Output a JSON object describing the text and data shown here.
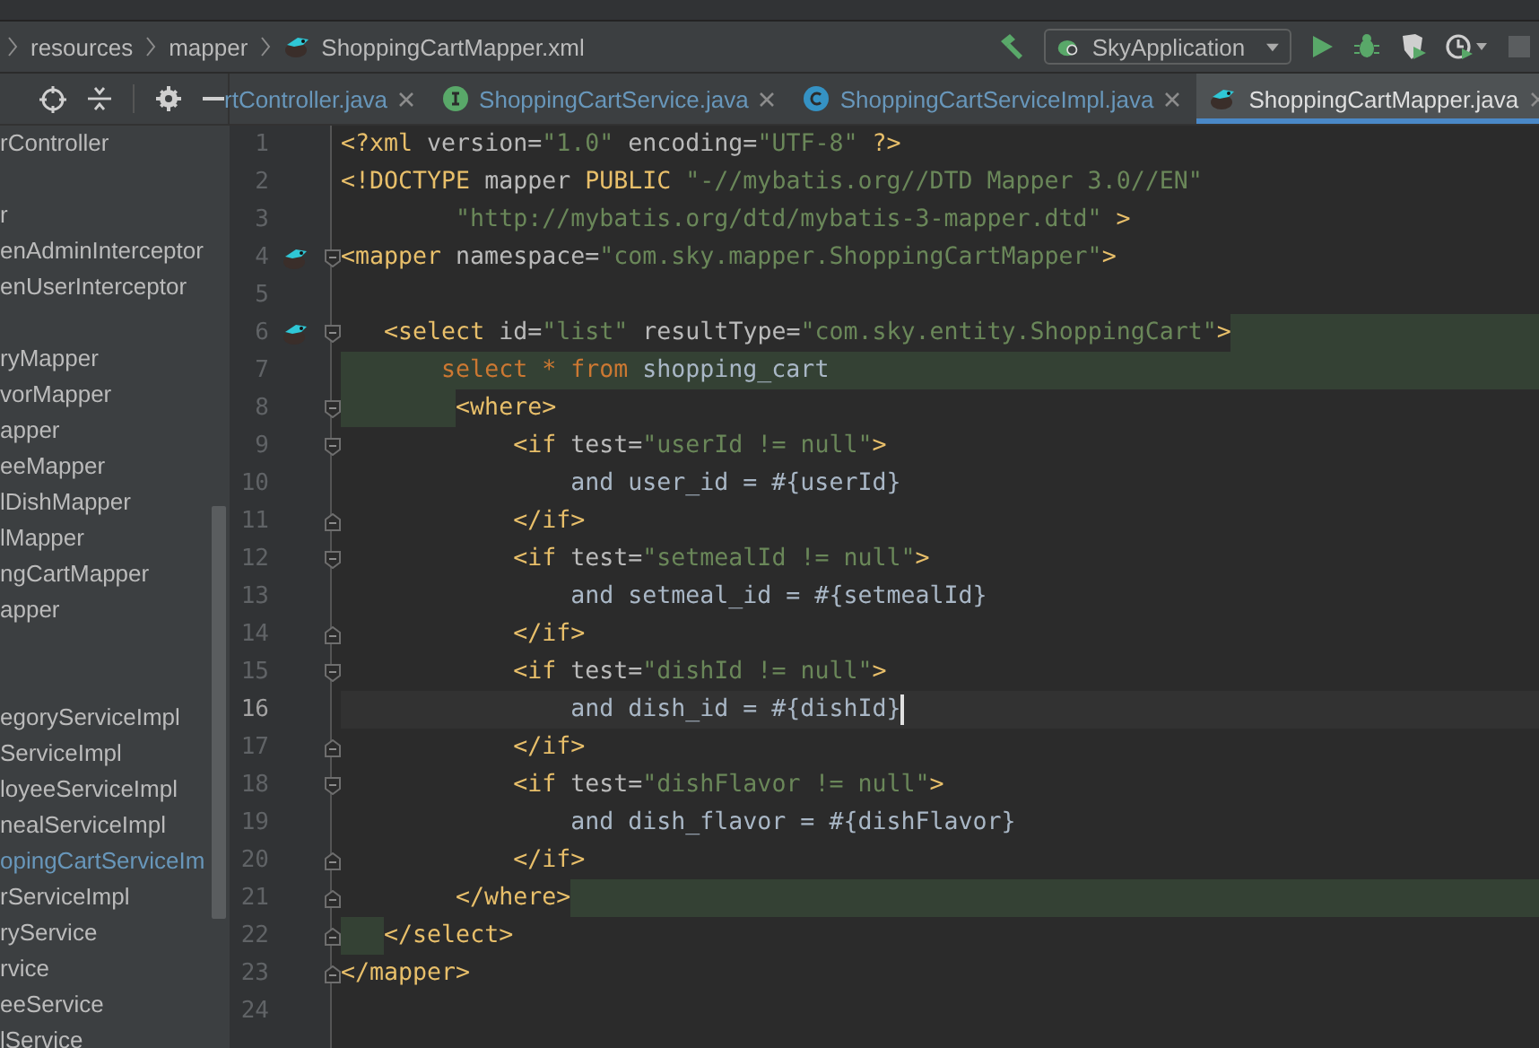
{
  "breadcrumb": {
    "items": [
      {
        "label": "resources",
        "kind": "folder"
      },
      {
        "label": "mapper",
        "kind": "folder"
      },
      {
        "label": "ShoppingCartMapper.xml",
        "kind": "xml"
      }
    ]
  },
  "toolbar": {
    "run_config": "SkyApplication"
  },
  "tabs": [
    {
      "label": "rtController.java",
      "kind": "plain",
      "selected": false,
      "modified": true
    },
    {
      "label": "ShoppingCartService.java",
      "kind": "interface",
      "selected": false,
      "modified": true
    },
    {
      "label": "ShoppingCartServiceImpl.java",
      "kind": "class",
      "selected": false,
      "modified": true
    },
    {
      "label": "ShoppingCartMapper.java",
      "kind": "mapper",
      "selected": true,
      "modified": false
    }
  ],
  "sidebar": {
    "items": [
      {
        "kind": "file",
        "label": "rController",
        "modified": false
      },
      {
        "kind": "spacer"
      },
      {
        "kind": "file",
        "label": "r",
        "modified": false
      },
      {
        "kind": "file",
        "label": "enAdminInterceptor",
        "modified": false
      },
      {
        "kind": "file",
        "label": "enUserInterceptor",
        "modified": false
      },
      {
        "kind": "spacer"
      },
      {
        "kind": "file",
        "label": "ryMapper",
        "modified": false
      },
      {
        "kind": "file",
        "label": "vorMapper",
        "modified": false
      },
      {
        "kind": "file",
        "label": "apper",
        "modified": false
      },
      {
        "kind": "file",
        "label": "eeMapper",
        "modified": false
      },
      {
        "kind": "file",
        "label": "lDishMapper",
        "modified": false
      },
      {
        "kind": "file",
        "label": "lMapper",
        "modified": false
      },
      {
        "kind": "file",
        "label": "ngCartMapper",
        "modified": false
      },
      {
        "kind": "file",
        "label": "apper",
        "modified": false
      },
      {
        "kind": "spacer"
      },
      {
        "kind": "spacer"
      },
      {
        "kind": "file",
        "label": "egoryServiceImpl",
        "modified": false
      },
      {
        "kind": "file",
        "label": "ServiceImpl",
        "modified": false
      },
      {
        "kind": "file",
        "label": "loyeeServiceImpl",
        "modified": false
      },
      {
        "kind": "file",
        "label": "nealServiceImpl",
        "modified": false
      },
      {
        "kind": "file",
        "label": "opingCartServiceIm",
        "modified": true
      },
      {
        "kind": "file",
        "label": "rServiceImpl",
        "modified": false
      },
      {
        "kind": "file",
        "label": "ryService",
        "modified": false
      },
      {
        "kind": "file",
        "label": "rvice",
        "modified": false
      },
      {
        "kind": "file",
        "label": "eeService",
        "modified": false
      },
      {
        "kind": "file",
        "label": "lService",
        "modified": false
      }
    ]
  },
  "editor": {
    "lines": [
      {
        "number": "1",
        "kind": "plain",
        "marker": false,
        "fold_start": false,
        "fold_end": false,
        "current": false,
        "tokens": [
          {
            "kind": "tag",
            "text": "<?xml "
          },
          {
            "kind": "attr",
            "text": "version="
          },
          {
            "kind": "str",
            "text": "\"1.0\" "
          },
          {
            "kind": "attr",
            "text": "encoding="
          },
          {
            "kind": "str",
            "text": "\"UTF-8\" "
          },
          {
            "kind": "tag",
            "text": "?>"
          }
        ]
      },
      {
        "number": "2",
        "kind": "plain",
        "marker": false,
        "fold_start": false,
        "fold_end": false,
        "current": false,
        "tokens": [
          {
            "kind": "tag",
            "text": "<!DOCTYPE "
          },
          {
            "kind": "attr",
            "text": "mapper "
          },
          {
            "kind": "tag",
            "text": "PUBLIC "
          },
          {
            "kind": "str",
            "text": "\"-//mybatis.org//DTD Mapper 3.0//EN\""
          }
        ]
      },
      {
        "number": "3",
        "kind": "plain",
        "marker": false,
        "fold_start": false,
        "fold_end": false,
        "current": false,
        "tokens": [
          {
            "kind": "str",
            "text": "        \"http://mybatis.org/dtd/mybatis-3-mapper.dtd\" "
          },
          {
            "kind": "tag",
            "text": ">"
          }
        ]
      },
      {
        "number": "4",
        "kind": "plain",
        "marker": true,
        "fold_start": true,
        "fold_end": false,
        "current": false,
        "tokens": [
          {
            "kind": "tag",
            "text": "<mapper "
          },
          {
            "kind": "attr",
            "text": "namespace="
          },
          {
            "kind": "str",
            "text": "\"com.sky.mapper.ShoppingCartMapper\""
          },
          {
            "kind": "tag",
            "text": ">"
          }
        ]
      },
      {
        "number": "5",
        "kind": "plain",
        "marker": false,
        "fold_start": false,
        "fold_end": false,
        "current": false
      },
      {
        "number": "6",
        "kind": "tail",
        "marker": true,
        "fold_start": true,
        "fold_end": false,
        "current": false,
        "tokens": [
          {
            "kind": "tag",
            "text": "   <select "
          },
          {
            "kind": "attr",
            "text": "id="
          },
          {
            "kind": "str",
            "text": "\"list\" "
          },
          {
            "kind": "attr",
            "text": "resultType="
          },
          {
            "kind": "str",
            "text": "\"com.sky.entity.ShoppingCart\""
          },
          {
            "kind": "tag",
            "text": ">"
          }
        ]
      },
      {
        "number": "7",
        "kind": "full",
        "marker": false,
        "fold_start": false,
        "fold_end": false,
        "current": false,
        "tokens": [
          {
            "kind": "kw",
            "text": "       select * from "
          },
          {
            "kind": "text",
            "text": "shopping_cart"
          }
        ]
      },
      {
        "number": "8",
        "kind": "head",
        "marker": false,
        "fold_start": true,
        "fold_end": false,
        "current": false,
        "tokens": [
          {
            "kind": "tag",
            "text": "        <where>"
          }
        ]
      },
      {
        "number": "9",
        "kind": "plain",
        "marker": false,
        "fold_start": true,
        "fold_end": false,
        "current": false,
        "tokens": [
          {
            "kind": "tag",
            "text": "            <if "
          },
          {
            "kind": "attr",
            "text": "test="
          },
          {
            "kind": "str",
            "text": "\"userId != null\""
          },
          {
            "kind": "tag",
            "text": ">"
          }
        ]
      },
      {
        "number": "10",
        "kind": "plain",
        "marker": false,
        "fold_start": false,
        "fold_end": false,
        "current": false,
        "tokens": [
          {
            "kind": "text",
            "text": "                and user_id = #{userId}"
          }
        ]
      },
      {
        "number": "11",
        "kind": "plain",
        "marker": false,
        "fold_start": false,
        "fold_end": true,
        "current": false,
        "tokens": [
          {
            "kind": "tag",
            "text": "            </if>"
          }
        ]
      },
      {
        "number": "12",
        "kind": "plain",
        "marker": false,
        "fold_start": true,
        "fold_end": false,
        "current": false,
        "tokens": [
          {
            "kind": "tag",
            "text": "            <if "
          },
          {
            "kind": "attr",
            "text": "test="
          },
          {
            "kind": "str",
            "text": "\"setmealId != null\""
          },
          {
            "kind": "tag",
            "text": ">"
          }
        ]
      },
      {
        "number": "13",
        "kind": "plain",
        "marker": false,
        "fold_start": false,
        "fold_end": false,
        "current": false,
        "tokens": [
          {
            "kind": "text",
            "text": "                and setmeal_id = #{setmealId}"
          }
        ]
      },
      {
        "number": "14",
        "kind": "plain",
        "marker": false,
        "fold_start": false,
        "fold_end": true,
        "current": false,
        "tokens": [
          {
            "kind": "tag",
            "text": "            </if>"
          }
        ]
      },
      {
        "number": "15",
        "kind": "plain",
        "marker": false,
        "fold_start": true,
        "fold_end": false,
        "current": false,
        "tokens": [
          {
            "kind": "tag",
            "text": "            <if "
          },
          {
            "kind": "attr",
            "text": "test="
          },
          {
            "kind": "str",
            "text": "\"dishId != null\""
          },
          {
            "kind": "tag",
            "text": ">"
          }
        ]
      },
      {
        "number": "16",
        "kind": "plain",
        "marker": false,
        "fold_start": false,
        "fold_end": false,
        "current": true,
        "tokens": [
          {
            "kind": "text",
            "text": "                and dish_id = #{dishId}"
          }
        ]
      },
      {
        "number": "17",
        "kind": "plain",
        "marker": false,
        "fold_start": false,
        "fold_end": true,
        "current": false,
        "tokens": [
          {
            "kind": "tag",
            "text": "            </if>"
          }
        ]
      },
      {
        "number": "18",
        "kind": "plain",
        "marker": false,
        "fold_start": true,
        "fold_end": false,
        "current": false,
        "tokens": [
          {
            "kind": "tag",
            "text": "            <if "
          },
          {
            "kind": "attr",
            "text": "test="
          },
          {
            "kind": "str",
            "text": "\"dishFlavor != null\""
          },
          {
            "kind": "tag",
            "text": ">"
          }
        ]
      },
      {
        "number": "19",
        "kind": "plain",
        "marker": false,
        "fold_start": false,
        "fold_end": false,
        "current": false,
        "tokens": [
          {
            "kind": "text",
            "text": "                and dish_flavor = #{dishFlavor}"
          }
        ]
      },
      {
        "number": "20",
        "kind": "plain",
        "marker": false,
        "fold_start": false,
        "fold_end": true,
        "current": false,
        "tokens": [
          {
            "kind": "tag",
            "text": "            </if>"
          }
        ]
      },
      {
        "number": "21",
        "kind": "tail",
        "marker": false,
        "fold_start": false,
        "fold_end": true,
        "current": false,
        "tokens": [
          {
            "kind": "tag",
            "text": "        </where>"
          }
        ]
      },
      {
        "number": "22",
        "kind": "head",
        "marker": false,
        "fold_start": false,
        "fold_end": true,
        "current": false,
        "tokens": [
          {
            "kind": "tag",
            "text": "   </select>"
          }
        ]
      },
      {
        "number": "23",
        "kind": "plain",
        "marker": false,
        "fold_start": false,
        "fold_end": true,
        "current": false,
        "tokens": [
          {
            "kind": "tag",
            "text": "</mapper>"
          }
        ]
      },
      {
        "number": "24",
        "kind": "plain",
        "marker": false,
        "fold_start": false,
        "fold_end": false,
        "current": false
      }
    ]
  }
}
